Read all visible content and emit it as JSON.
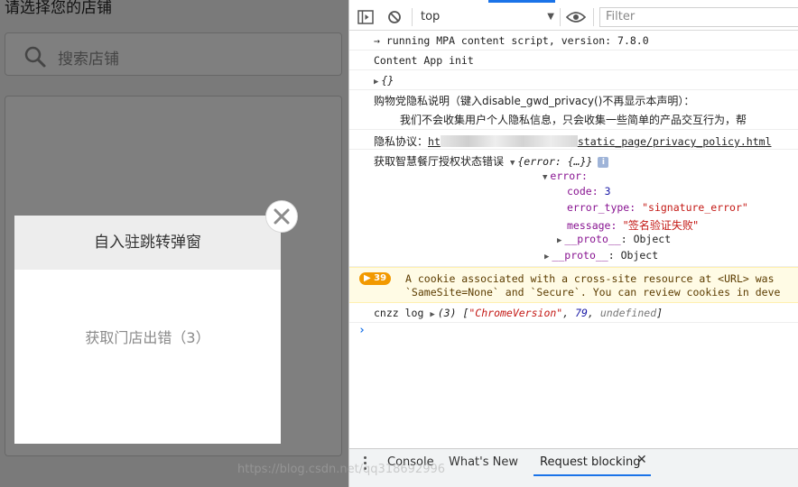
{
  "app": {
    "page_title": "请选择您的店铺",
    "search_placeholder": "搜索店铺"
  },
  "modal": {
    "title": "自入驻跳转弹窗",
    "message": "获取门店出错（3）",
    "close_icon": "close-icon"
  },
  "devtools": {
    "toolbar": {
      "context": "top",
      "filter_placeholder": "Filter"
    },
    "console": {
      "line1": "→ running MPA content script, version: 7.8.0",
      "line2": "Content App init",
      "line3": "{}",
      "line4": "购物党隐私说明（键入disable_gwd_privacy()不再显示本声明）：",
      "line5": "我们不会收集用户个人隐私信息，只会收集一些简单的产品交互行为，帮",
      "privacy_label": "隐私协议：",
      "privacy_url_start": "ht",
      "privacy_url_end": "static_page/privacy_policy.html",
      "error_label": "获取智慧餐厅授权状态错误",
      "error_summary": "{error: {…}}",
      "info_icon": "i",
      "error_key": "error:",
      "code_key": "code:",
      "code_val": "3",
      "type_key": "error_type:",
      "type_val": "\"signature_error\"",
      "message_key": "message:",
      "message_val": "\"签名验证失败\"",
      "proto_key": "__proto__",
      "proto_val": ": Object",
      "warn_count": "39",
      "warn_line1": "A cookie associated with a cross-site resource at <URL> was",
      "warn_line2": "`SameSite=None` and `Secure`. You can review cookies in deve",
      "cnzz_label": "cnzz log",
      "cnzz_count": "(3) [",
      "cnzz_v1": "\"ChromeVersion\"",
      "cnzz_v2": "79",
      "cnzz_v3": "undefined",
      "cnzz_end": "]",
      "prompt": "›"
    },
    "drawer": {
      "tabs": [
        "Console",
        "What's New",
        "Request blocking"
      ],
      "active_tab": "Request blocking",
      "close": "✕"
    },
    "watermark": "https://blog.csdn.net/qq318692996"
  },
  "colors": {
    "accent": "#1a73e8",
    "warning_badge": "#f29900",
    "overlay": "rgba(0,0,0,0.5)"
  }
}
